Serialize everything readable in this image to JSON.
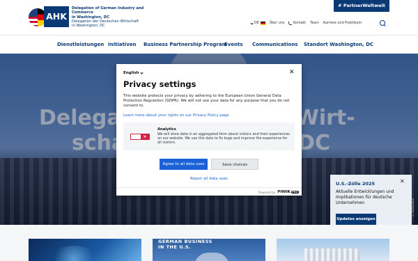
{
  "header": {
    "logo_mark": "AHK",
    "logo_lines_en": [
      "Delegation of German Industry and Commerce",
      "in Washington, DC"
    ],
    "logo_lines_de": [
      "Delegation der Deutschen Wirtschaft",
      "in Washington, DC"
    ],
    "partner_button": "# PartnerWeltweit",
    "util_nav": {
      "language": "DE",
      "about": "Über uns",
      "contact": "Kontakt",
      "team": "Team",
      "careers": "Karriere und Praktikum"
    }
  },
  "main_nav": [
    "Dienstleistungen",
    "Initiativen",
    "Business Partnership Program",
    "Events",
    "Communications",
    "Standort Washington, DC"
  ],
  "hero": {
    "title_line1": "Delegat",
    "title_line1_right": "n Wirt-",
    "title_line2": "scha",
    "title_line2_right": ", DC"
  },
  "modal": {
    "language": "English",
    "close": "✕",
    "title": "Privacy settings",
    "description": "This website protects your privacy by adhering to the European Union General Data Protection Regulation (GDPR). We will not use your data for any purpose that you do not consent to.",
    "policy_link": "Learn more about your rights on our Privacy Policy page",
    "analytics": {
      "title": "Analytics",
      "description": "We will store data in an aggregated form about visitors and their experiences on our website. We use this data to fix bugs and improve the experience for all visitors.",
      "toggle_state": "off"
    },
    "agree_button": "Agree to all data uses",
    "save_button": "Save choices",
    "reject_link": "Reject all data uses",
    "powered_by": "Powered by",
    "brand": "PIWIK",
    "brand_suffix": "PRO"
  },
  "promo": {
    "title": "U.S.-Zölle 2025",
    "close": "✕",
    "text": "Aktuelle Entwicklungen und Implikationen für deutsche Unternehmen",
    "button": "Updates anzeigen"
  },
  "photo_credit": "© Shutterstock",
  "cards": [
    {
      "text": ""
    },
    {
      "text_line1": "GERMAN BUSINESS",
      "text_line2": "IN THE U.S."
    },
    {
      "text": ""
    }
  ],
  "colors": {
    "brand_navy": "#0a3a75",
    "link_blue": "#1b62d8",
    "toggle_red": "#d4213f"
  }
}
